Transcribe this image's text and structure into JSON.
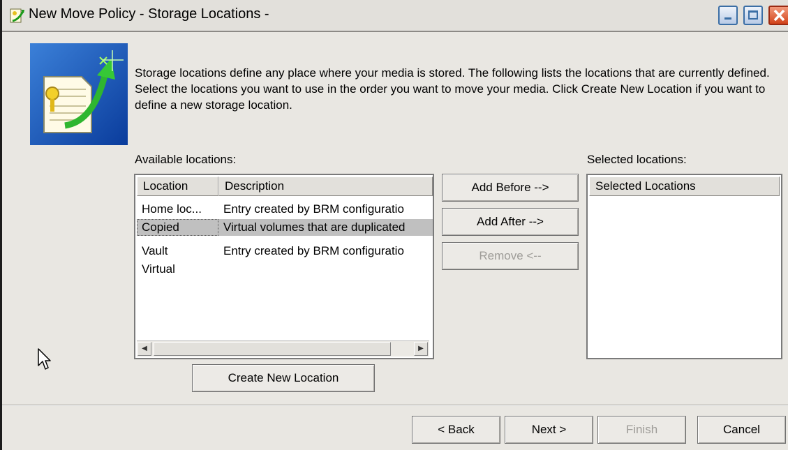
{
  "window": {
    "title": "New Move Policy - Storage Locations -",
    "icons": {
      "app": "wizard-app-icon",
      "minimize": "minimize-icon",
      "maximize": "maximize-icon",
      "close": "close-icon"
    }
  },
  "intro": {
    "text": "Storage locations define any place where your media is stored.  The following lists the locations that are currently defined.  Select the locations you want to use in the order you want to move your media.  Click Create New Location if you want to define a new storage location."
  },
  "available": {
    "label": "Available locations:",
    "columns": [
      "Location",
      "Description"
    ],
    "rows": [
      {
        "location": "Home loc...",
        "description": "Entry created by BRM configuratio"
      },
      {
        "location": "Copied",
        "description": "Virtual volumes that are duplicated"
      },
      {
        "location": "Vault",
        "description": "Entry created by BRM configuratio"
      },
      {
        "location": "Virtual",
        "description": ""
      }
    ],
    "selected_row": 1
  },
  "buttons": {
    "add_before": "Add Before -->",
    "add_after": "Add After -->",
    "remove": "Remove <--",
    "create_new": "Create New Location"
  },
  "selected": {
    "label": "Selected locations:",
    "column": "Selected Locations"
  },
  "footer": {
    "back": "< Back",
    "next": "Next >",
    "finish": "Finish",
    "cancel": "Cancel"
  },
  "colors": {
    "window_bg": "#e9e7e2",
    "selection": "#c0c0c0",
    "disabled_text": "#9e9c98"
  }
}
